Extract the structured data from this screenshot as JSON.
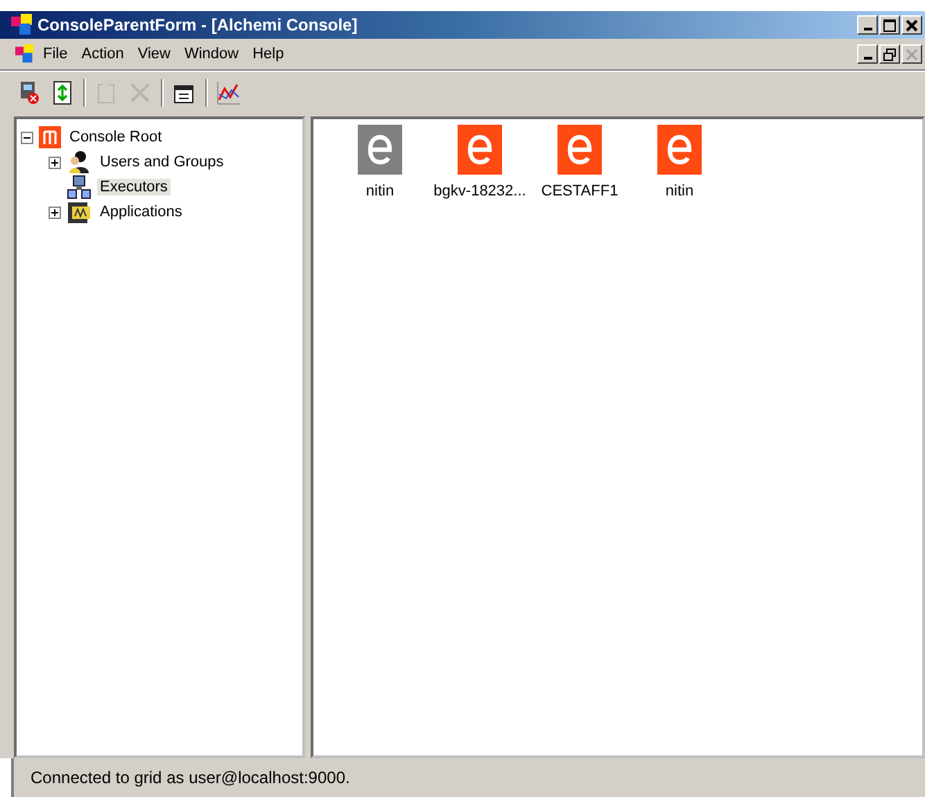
{
  "window": {
    "title": "ConsoleParentForm - [Alchemi Console]"
  },
  "menu": [
    {
      "label": "File"
    },
    {
      "label": "Action"
    },
    {
      "label": "View"
    },
    {
      "label": "Window"
    },
    {
      "label": "Help"
    }
  ],
  "toolbar": [
    {
      "kind": "disconnect",
      "disabled": false
    },
    {
      "kind": "refresh",
      "disabled": false
    },
    {
      "kind": "paste",
      "disabled": true
    },
    {
      "kind": "delete",
      "disabled": true
    },
    {
      "kind": "properties",
      "disabled": false
    },
    {
      "kind": "chart",
      "disabled": false
    }
  ],
  "tree": [
    {
      "label": "Console Root",
      "kind": "root",
      "expanded": true,
      "selected": false,
      "children": [
        {
          "label": "Users and Groups",
          "kind": "users",
          "expanded": false,
          "selected": false
        },
        {
          "label": "Executors",
          "kind": "executors",
          "selected": true
        },
        {
          "label": "Applications",
          "kind": "apps",
          "expanded": false,
          "selected": false
        }
      ]
    }
  ],
  "executors": [
    {
      "label": "nitin",
      "color": "#808080"
    },
    {
      "label": "bgkv-18232...",
      "color": "#ff4a12"
    },
    {
      "label": "CESTAFF1",
      "color": "#ff4a12"
    },
    {
      "label": "nitin",
      "color": "#ff4a12"
    }
  ],
  "status_bar": "Connected to grid as user@localhost:9000."
}
